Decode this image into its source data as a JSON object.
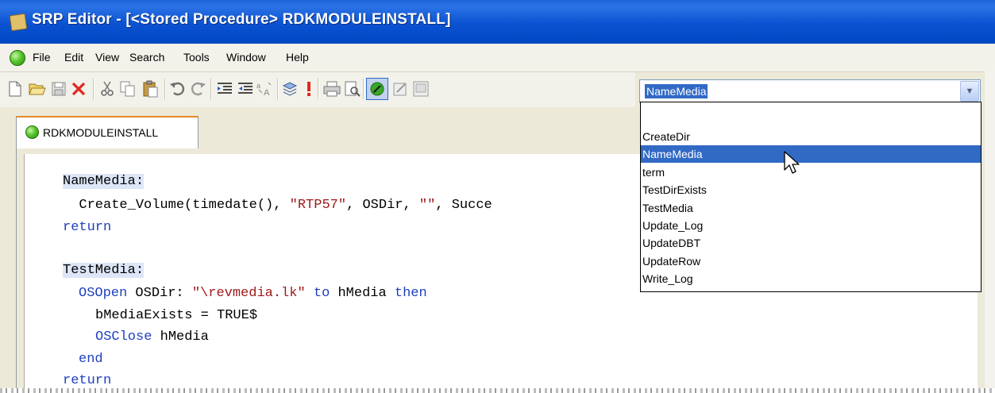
{
  "window": {
    "title": "SRP Editor - [<Stored Procedure> RDKMODULEINSTALL]"
  },
  "menu": [
    "File",
    "Edit",
    "View",
    "Search",
    "Tools",
    "Window",
    "Help"
  ],
  "toolbar": {
    "icons": [
      "new-file-icon",
      "open-folder-icon",
      "save-icon",
      "delete-icon",
      "cut-icon",
      "copy-icon",
      "paste-icon",
      "undo-icon",
      "redo-icon",
      "indent-icon",
      "outdent-icon",
      "replace-icon",
      "compile-icon",
      "breakpoint-icon",
      "print-icon",
      "print-preview-icon",
      "check-syntax-icon",
      "edit-record-icon",
      "properties-icon"
    ],
    "label_combo_value": "NameMedia"
  },
  "tab": {
    "label": "RDKMODULEINSTALL"
  },
  "code": {
    "l1_label": "NameMedia:",
    "l2_indent": "  ",
    "l2_a": "Create_Volume(timedate(), ",
    "l2_str1": "\"RTP57\"",
    "l2_b": ", OSDir, ",
    "l2_str2": "\"\"",
    "l2_c": ", Succe",
    "l3": "return",
    "l5_label": "TestMedia:",
    "l6_kw1": "OSOpen",
    "l6_a": " OSDir: ",
    "l6_str": "\"\\revmedia.lk\"",
    "l6_kw2": " to",
    "l6_b": " hMedia ",
    "l6_kw3": "then",
    "l7": "bMediaExists = TRUE$",
    "l8_kw": "OSClose",
    "l8_a": " hMedia",
    "l9": "end",
    "l10": "return"
  },
  "dropdown": {
    "options": [
      "",
      "CreateDir",
      "NameMedia",
      "term",
      "TestDirExists",
      "TestMedia",
      "Update_Log",
      "UpdateDBT",
      "UpdateRow",
      "Write_Log"
    ],
    "selected": "NameMedia"
  },
  "colors": {
    "titlebar": "#0a52d1",
    "selection": "#316ac5",
    "keyword": "#1f3fbf",
    "string": "#a01b1b",
    "label_highlight": "#dde6f7"
  }
}
